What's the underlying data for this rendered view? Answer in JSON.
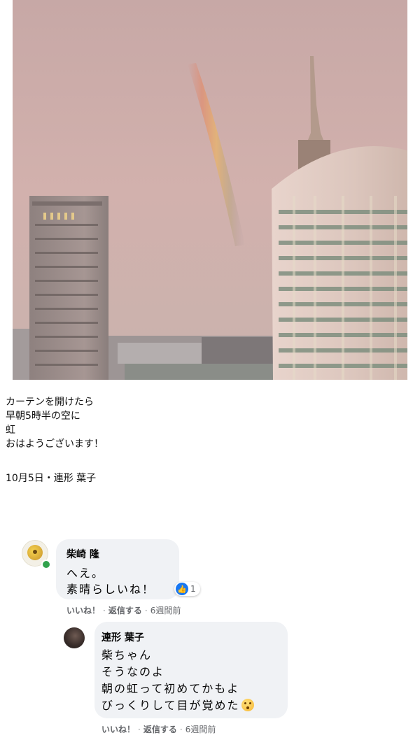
{
  "post": {
    "lines": [
      "カーテンを開けたら",
      "早朝5時半の空に",
      "虹",
      "おはようございます！"
    ],
    "meta": "10月5日・連形 葉子"
  },
  "comments": [
    {
      "author": "柴崎 隆",
      "lines": [
        "へえ。",
        "素晴らしいね！"
      ],
      "like_count": "1",
      "actions": {
        "like": "いいね！",
        "reply": "返信する",
        "time": "6週間前"
      }
    },
    {
      "author": "連形 葉子",
      "lines": [
        "柴ちゃん",
        "そうなのよ",
        "朝の虹って初めてかもよ",
        "びっくりして目が覚めた"
      ],
      "emoji": "flushed-face-emoji",
      "actions": {
        "like": "いいね！",
        "reply": "返信する",
        "time": "6週間前"
      }
    }
  ],
  "colors": {
    "like_blue": "#1877f2",
    "bubble": "#f0f2f5",
    "online": "#31a24c",
    "meta_text": "#65676b"
  }
}
